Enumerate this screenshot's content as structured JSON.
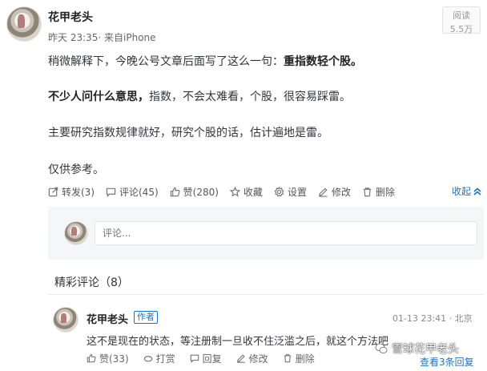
{
  "post": {
    "author": "花甲老头",
    "meta": "昨天 23:35· 来自iPhone",
    "read_label": "阅读",
    "read_count": "5.5万",
    "line1_normal": "稍微解释下，今晚公号文章后面写了这么一句：",
    "line1_bold": "重指数轻个股。",
    "line2_bold": "不少人问什么意思，",
    "line2_normal": "指数，不会太难看，个股，很容易踩雷。",
    "line3": "主要研究指数规律就好，研究个股的话，估计遍地是雷。",
    "line4": "仅供参考。"
  },
  "actions": {
    "forward": "转发(3)",
    "comment": "评论(45)",
    "like": "赞(280)",
    "favorite": "收藏",
    "settings": "设置",
    "edit": "修改",
    "delete": "删除",
    "collapse": "收起"
  },
  "compose": {
    "placeholder": "评论..."
  },
  "hot_comments": {
    "title": "精彩评论（8）",
    "items": [
      {
        "author": "花甲老头",
        "badge": "作者",
        "time": "01-13 23:41 · 北京",
        "text": "这不是现在的状态，等注册制一旦收不住泛滥之后，就这个方法吧",
        "like": "赞(33)",
        "reward": "打赏",
        "reply": "回复",
        "edit": "修改",
        "delete": "删除",
        "more_replies": "查看3条回复"
      }
    ]
  },
  "watermark": "雪球花甲老头",
  "colors": {
    "link": "#1a73c8",
    "text": "#33353c",
    "muted": "#888888",
    "compose_bg": "#f5f6f7"
  }
}
